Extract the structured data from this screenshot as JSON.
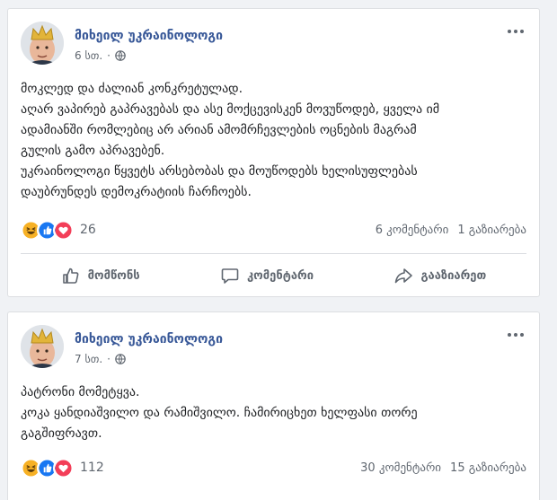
{
  "posts": [
    {
      "author": "მიხეილ უკრაინოლოგი",
      "time": "6 სთ.",
      "lines": [
        "მოკლედ და ძალიან კონკრეტულად.",
        "აღარ ვაპირებ გაპრავებას და ასე მოქცევისკენ მოვუწოდებ, ყველა იმ",
        "ადამიანში რომლებიც არ არიან ამომრჩევლების ოცნების მაგრამ",
        "გულის გამო აპრავებენ.",
        "უკრაინოლოგი წყვეტს არსებობას და მოუწოდებს ხელისუფლებას",
        "დაუბრუნდეს დემოკრატიის ჩარჩოებს."
      ],
      "reaction_count": "26",
      "comments": "6 კომენტარი",
      "shares": "1 გაზიარება"
    },
    {
      "author": "მიხეილ უკრაინოლოგი",
      "time": "7 სთ.",
      "lines": [
        "პატრონი მომეტყვა.",
        "კოკა ყანდიაშვილო და რამიშვილო. ჩამირიცხეთ ხელფასი თორე",
        "გაგშიფრავთ."
      ],
      "reaction_count": "112",
      "comments": "30 კომენტარი",
      "shares": "15 გაზიარება"
    }
  ],
  "actions": {
    "like": "მომწონს",
    "comment": "კომენტარი",
    "share": "გააზიარეთ"
  },
  "icons": [
    "globe-icon",
    "more-icon",
    "haha-reaction-icon",
    "like-reaction-icon",
    "love-reaction-icon",
    "like-icon",
    "comment-icon",
    "share-icon"
  ],
  "colors": {
    "author": "#385898",
    "like": "#1877f2",
    "love": "#f33e58",
    "haha": "#f7b125"
  }
}
